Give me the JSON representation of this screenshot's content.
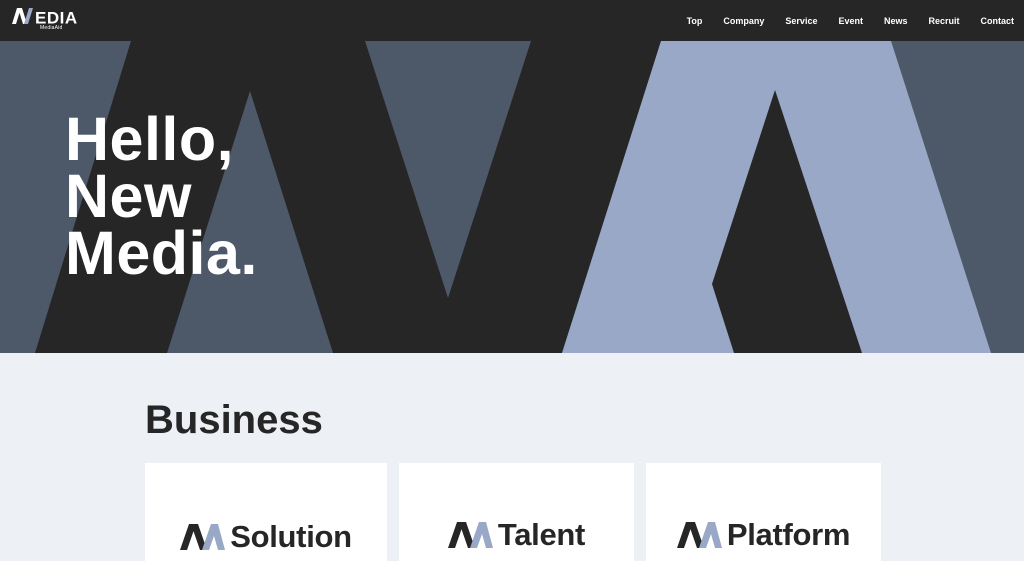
{
  "header": {
    "logo_text": "MEDIA",
    "logo_subtext": "MediaAid",
    "nav": [
      {
        "label": "Top"
      },
      {
        "label": "Company"
      },
      {
        "label": "Service"
      },
      {
        "label": "Event"
      },
      {
        "label": "News"
      },
      {
        "label": "Recruit"
      },
      {
        "label": "Contact"
      }
    ]
  },
  "hero": {
    "lines": [
      "Hello,",
      "New",
      "Media."
    ]
  },
  "business": {
    "title": "Business",
    "cards": [
      {
        "label": "Solution",
        "icon": "ma-logo-mark-icon"
      },
      {
        "label": "Talent",
        "icon": "ma-logo-mark-icon"
      },
      {
        "label": "Platform",
        "icon": "ma-logo-mark-icon"
      }
    ]
  },
  "colors": {
    "header_bg": "#262626",
    "hero_dark": "#262626",
    "hero_slate": "#4d5868",
    "hero_light": "#98a8c6",
    "page_bg": "#edf0f5"
  }
}
